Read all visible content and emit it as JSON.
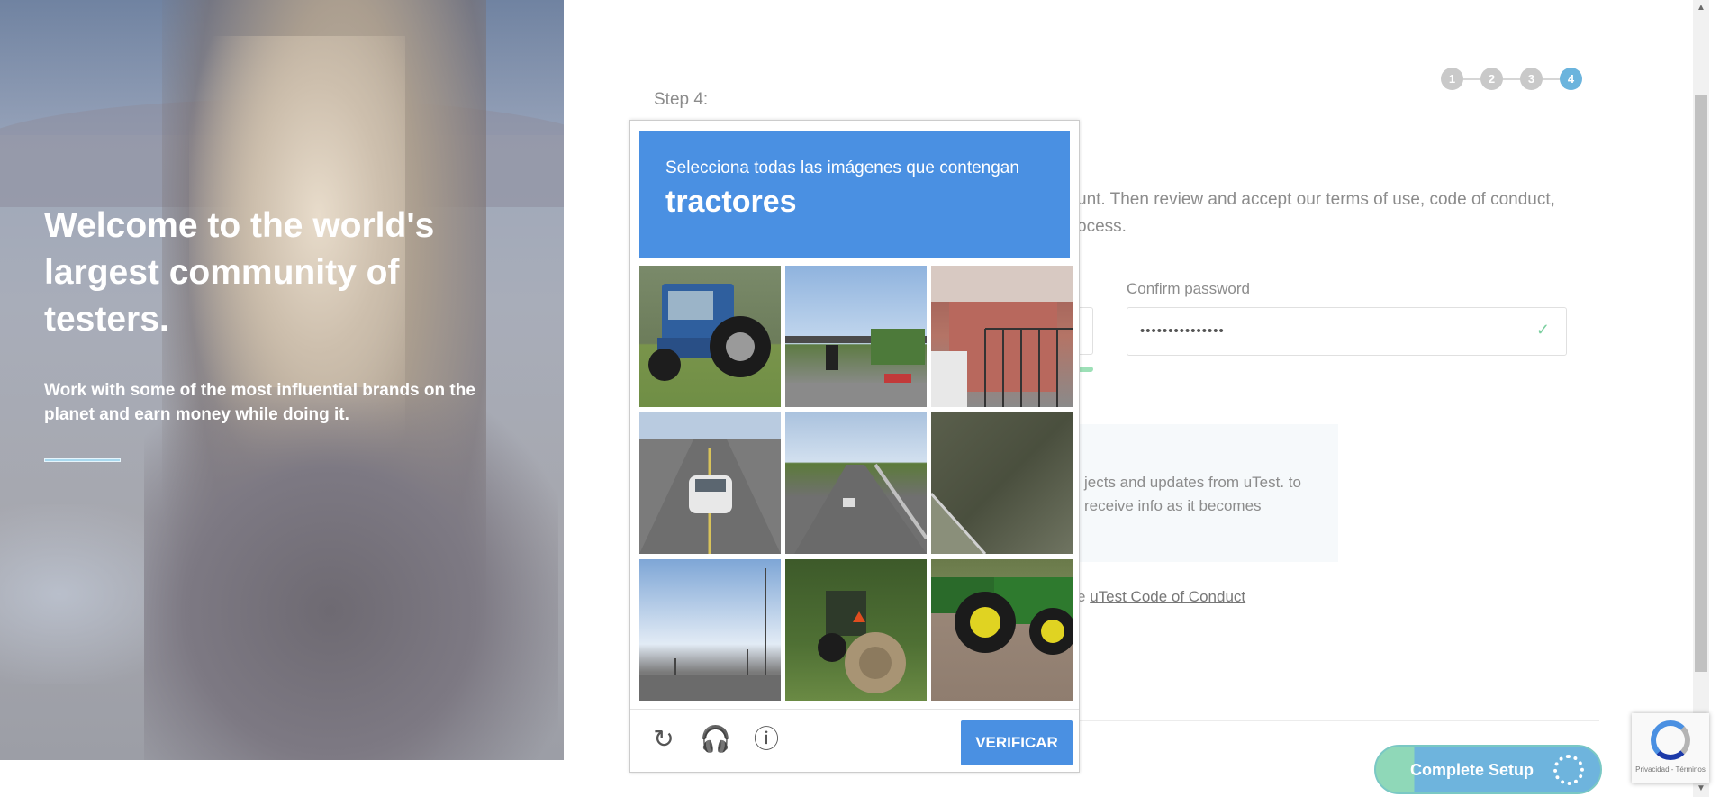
{
  "hero": {
    "headline": "Welcome to the world's largest community of testers.",
    "tagline": "Work with some of the most influential brands on the planet and earn money while doing it."
  },
  "stepper": {
    "steps": [
      "1",
      "2",
      "3",
      "4"
    ],
    "active": "4"
  },
  "form": {
    "step_label": "Step 4:",
    "intro_text": "unt. Then review and accept our terms of use, code of conduct, ocess.",
    "confirm_password_label": "Confirm password",
    "confirm_password_value": "•••••••••••••••",
    "info_text": "jects and updates from uTest. to receive info as it becomes",
    "coc_prefix": "e ",
    "coc_link": "uTest Code of Conduct",
    "complete_button": "Complete Setup"
  },
  "captcha": {
    "instruction": "Selecciona todas las imágenes que contengan",
    "target": "tractores",
    "verify_label": "VERIFICAR",
    "tiles": [
      "tractor-blue",
      "street-traffic-light",
      "house-steps",
      "highway-car",
      "highway-road",
      "roof",
      "street-poles",
      "tractor-hay",
      "tractor-green"
    ]
  },
  "recaptcha_badge": {
    "text": "Privacidad - Términos"
  },
  "colors": {
    "captcha_blue": "#4a90e2",
    "step_active": "#6bb4dd",
    "success": "#7ccfa0"
  }
}
